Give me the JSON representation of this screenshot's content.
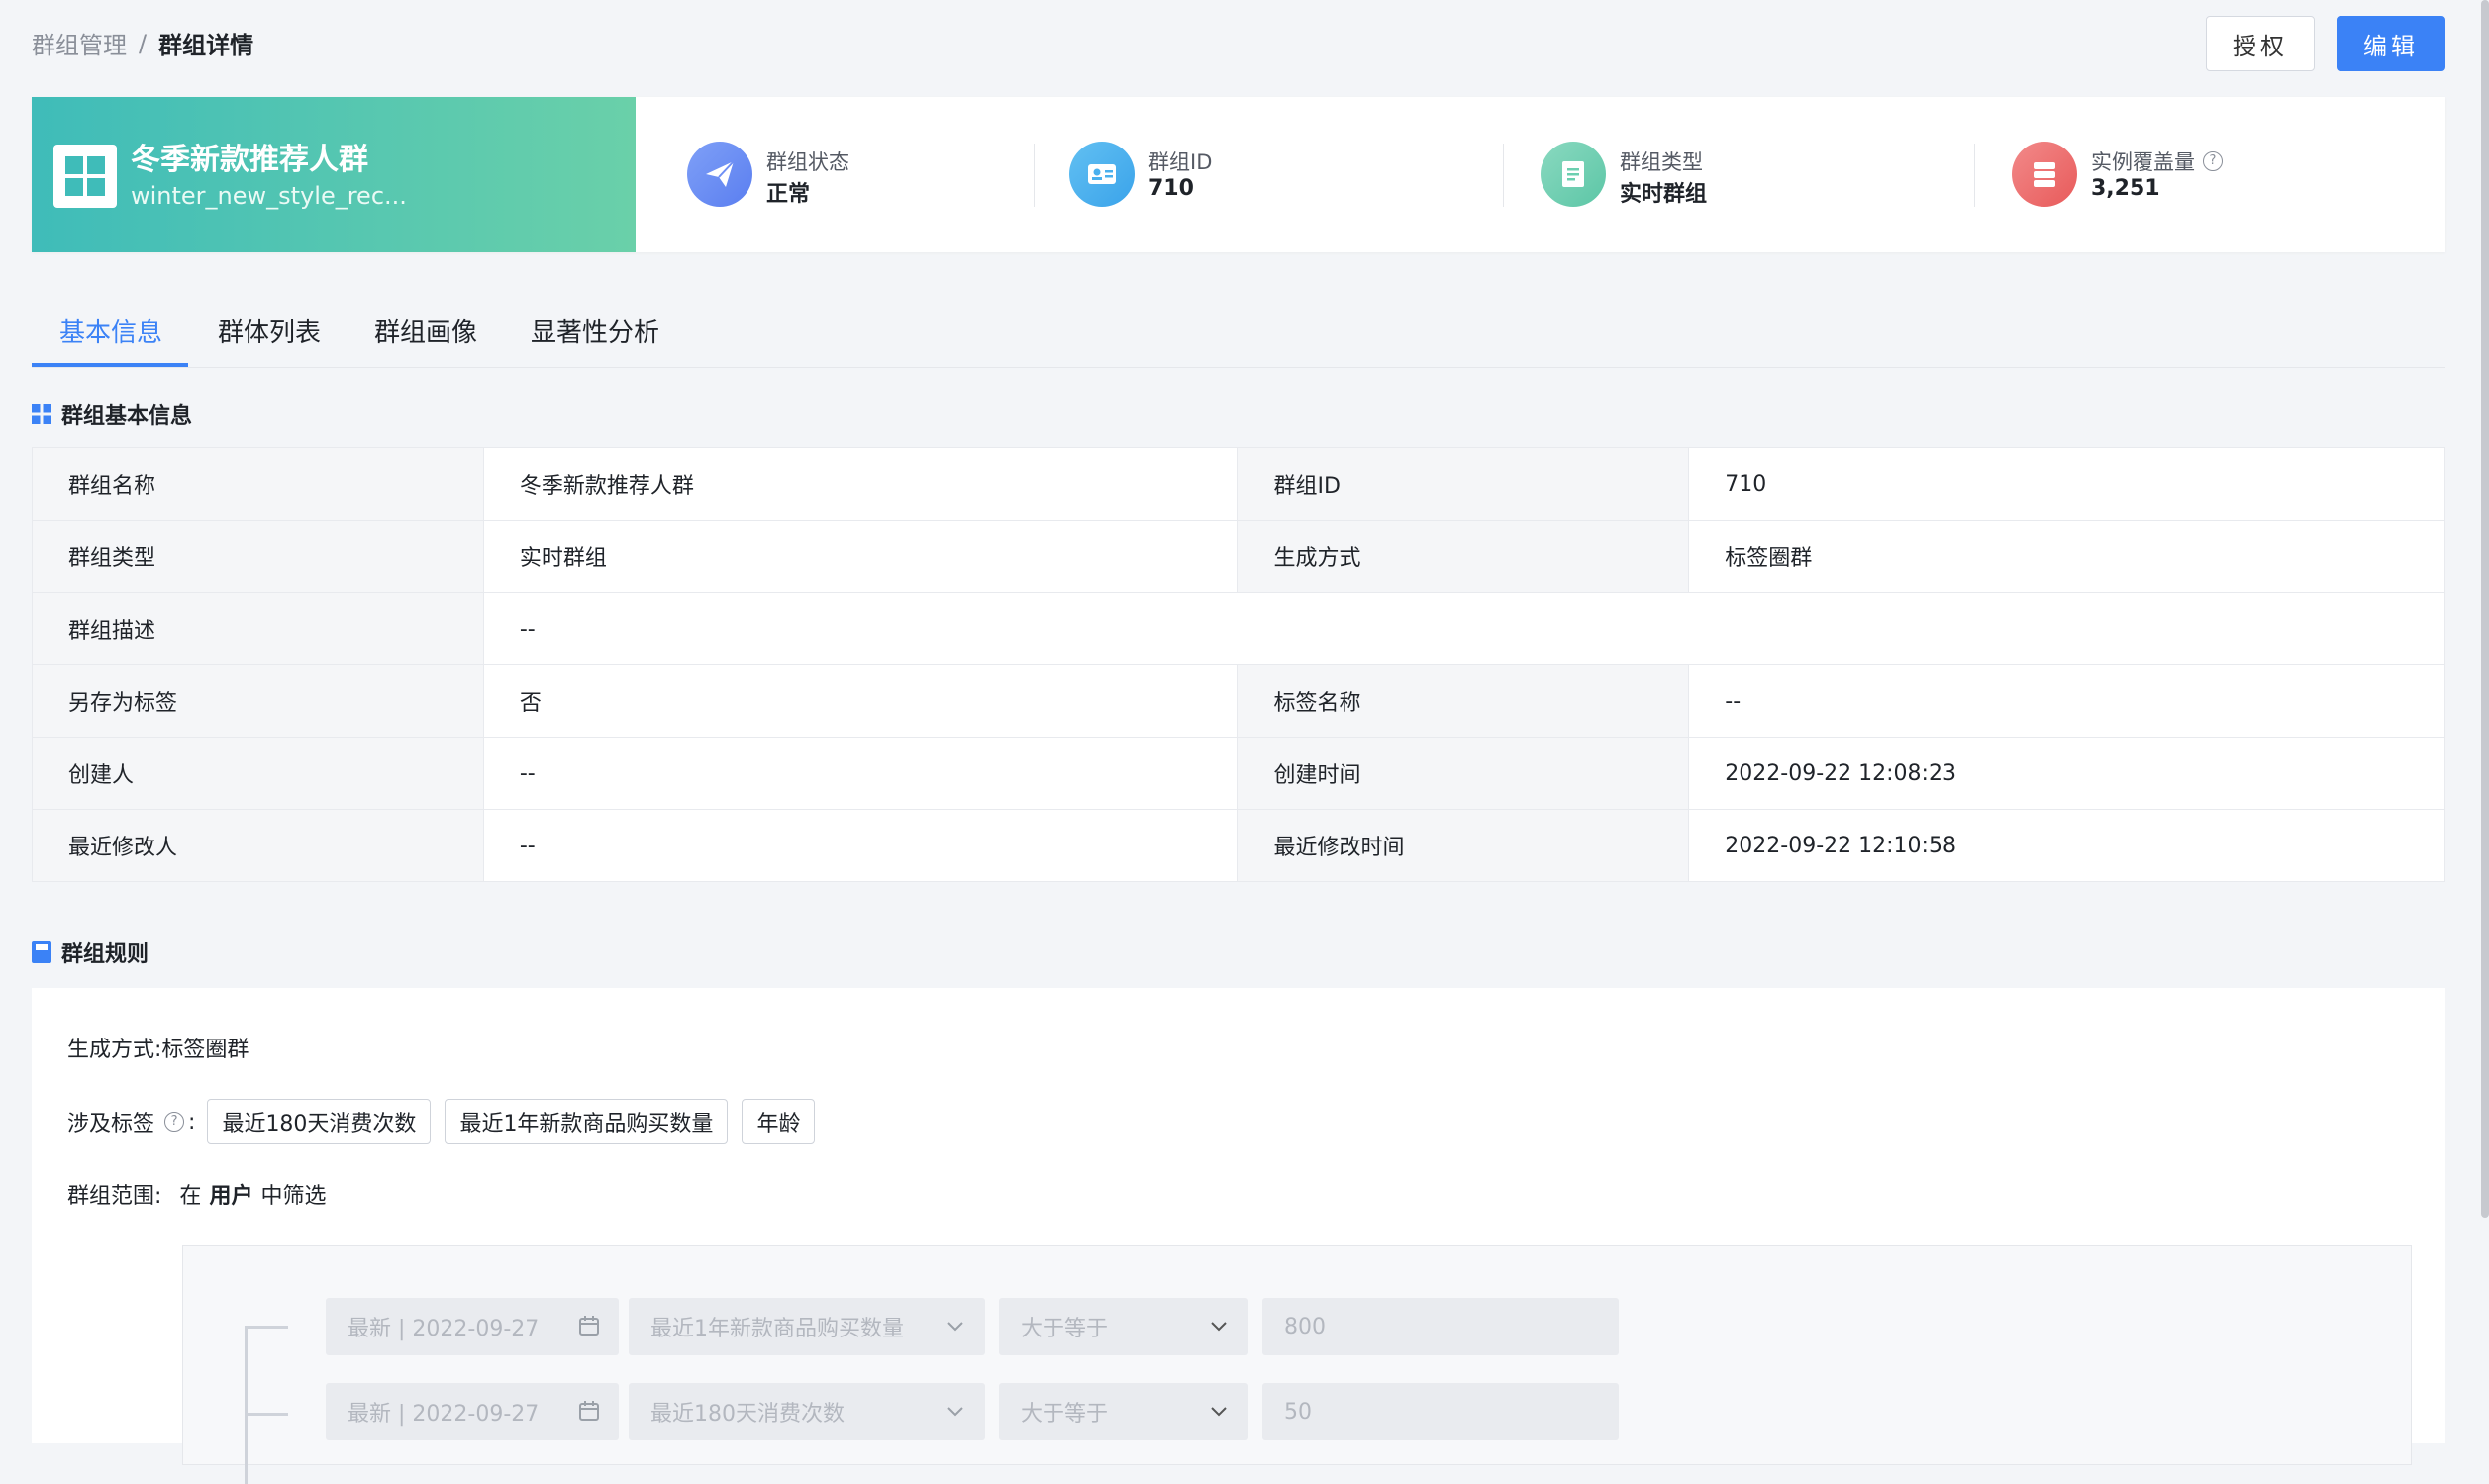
{
  "breadcrumb": {
    "parent": "群组管理",
    "separator": "/",
    "current": "群组详情"
  },
  "actions": {
    "authorize": "授权",
    "edit": "编辑"
  },
  "summary": {
    "title": "冬季新款推荐人群",
    "code": "winter_new_style_rec...",
    "stats": [
      {
        "label": "群组状态",
        "value": "正常",
        "icon": "paper-plane-icon",
        "color": "#6e8ff5"
      },
      {
        "label": "群组ID",
        "value": "710",
        "icon": "id-card-icon",
        "color": "#4ab0ee"
      },
      {
        "label": "群组类型",
        "value": "实时群组",
        "icon": "document-icon",
        "color": "#6ccfb0"
      },
      {
        "label": "实例覆盖量",
        "value": "3,251",
        "icon": "database-icon",
        "color": "#ec6b6b",
        "help": "?"
      }
    ]
  },
  "tabs": [
    "基本信息",
    "群体列表",
    "群组画像",
    "显著性分析"
  ],
  "basic_info": {
    "title": "群组基本信息",
    "rows": [
      [
        "群组名称",
        "冬季新款推荐人群",
        "群组ID",
        "710"
      ],
      [
        "群组类型",
        "实时群组",
        "生成方式",
        "标签圈群"
      ],
      [
        "群组描述",
        "--"
      ],
      [
        "另存为标签",
        "否",
        "标签名称",
        "--"
      ],
      [
        "创建人",
        "--",
        "创建时间",
        "2022-09-22 12:08:23"
      ],
      [
        "最近修改人",
        "--",
        "最近修改时间",
        "2022-09-22 12:10:58"
      ]
    ]
  },
  "rules": {
    "title": "群组规则",
    "method_label": "生成方式:",
    "method_value": "标签圈群",
    "tags_label": "涉及标签",
    "tags_colon": ":",
    "help": "?",
    "tags": [
      "最近180天消费次数",
      "最近1年新款商品购买数量",
      "年龄"
    ],
    "scope_label": "群组范围:",
    "scope_pre": "在",
    "scope_entity": "用户",
    "scope_post": "中筛选",
    "conditions": [
      {
        "date": "最新 | 2022-09-27",
        "tag": "最近1年新款商品购买数量",
        "op": "大于等于",
        "value": "800"
      },
      {
        "date": "最新 | 2022-09-27",
        "tag": "最近180天消费次数",
        "op": "大于等于",
        "value": "50"
      }
    ]
  }
}
